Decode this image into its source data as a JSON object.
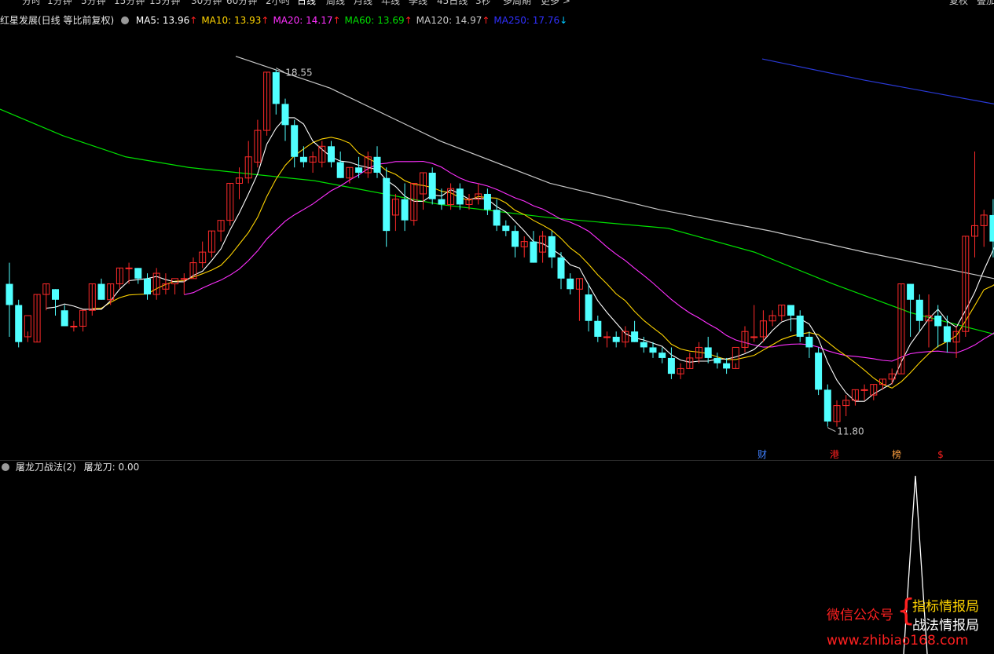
{
  "toolbar": {
    "tabs": [
      "分时",
      "1分钟",
      "5分钟",
      "15分钟",
      "15分钟",
      "30分钟",
      "60分钟",
      "2小时",
      "日线",
      "周线",
      "月线",
      "年线",
      "季线",
      "45日线",
      "3秒",
      "多周期",
      "更多 >"
    ],
    "active_index": 8,
    "right_buttons": [
      "复权",
      "叠加"
    ]
  },
  "stock": {
    "title": "红星发展(日线 等比前复权)"
  },
  "ma": [
    {
      "label": "MA5: 13.96",
      "arrow": "↑",
      "color": "#ffffff",
      "arrow_dir": "up"
    },
    {
      "label": "MA10: 13.93",
      "arrow": "↑",
      "color": "#ffd400",
      "arrow_dir": "up"
    },
    {
      "label": "MA20: 14.17",
      "arrow": "↑",
      "color": "#ff30ff",
      "arrow_dir": "up"
    },
    {
      "label": "MA60: 13.69",
      "arrow": "↑",
      "color": "#00e000",
      "arrow_dir": "up"
    },
    {
      "label": "MA120: 14.97",
      "arrow": "↑",
      "color": "#c8c8c8",
      "arrow_dir": "up"
    },
    {
      "label": "MA250: 17.76",
      "arrow": "↓",
      "color": "#3030ff",
      "arrow_dir": "down"
    }
  ],
  "colors": {
    "up": "#ff2a2a",
    "down": "#50ffff",
    "ma5": "#ffffff",
    "ma10": "#ffd400",
    "ma20": "#ff30ff",
    "ma60": "#00e000",
    "ma120": "#c8c8c8",
    "ma250": "#2a3ad8"
  },
  "chart_data": {
    "type": "candlestick",
    "price_range": [
      11.2,
      19.3
    ],
    "annotations": {
      "high": "18.55",
      "low": "11.80"
    },
    "markers": [
      {
        "index": 80,
        "text": "财",
        "color": "#4080ff"
      },
      {
        "index": 88,
        "text": "港",
        "color": "#ff2020"
      },
      {
        "index": 95,
        "text": "榜",
        "color": "#ffa040"
      },
      {
        "index": 100,
        "text": "$",
        "color": "#ff2020"
      }
    ],
    "candles": [
      [
        14.5,
        14.9,
        14.1,
        13.5
      ],
      [
        14.1,
        14.2,
        13.4,
        13.3
      ],
      [
        13.5,
        13.6,
        13.9,
        13.4
      ],
      [
        13.4,
        14.3,
        14.3,
        13.4
      ],
      [
        14.3,
        14.5,
        14.5,
        14.0
      ],
      [
        14.4,
        14.4,
        14.2,
        13.9
      ],
      [
        14.0,
        14.1,
        13.7,
        13.7
      ],
      [
        13.7,
        13.8,
        13.7,
        13.6
      ],
      [
        13.7,
        14.0,
        14.0,
        13.6
      ],
      [
        14.0,
        14.5,
        14.5,
        13.9
      ],
      [
        14.5,
        14.6,
        14.2,
        14.2
      ],
      [
        14.2,
        14.5,
        14.5,
        14.1
      ],
      [
        14.5,
        14.8,
        14.8,
        14.4
      ],
      [
        14.8,
        14.9,
        14.8,
        14.5
      ],
      [
        14.8,
        14.8,
        14.6,
        14.5
      ],
      [
        14.6,
        14.7,
        14.3,
        14.2
      ],
      [
        14.3,
        14.8,
        14.7,
        14.2
      ],
      [
        14.4,
        14.7,
        14.5,
        14.3
      ],
      [
        14.5,
        14.5,
        14.6,
        14.3
      ],
      [
        14.6,
        14.7,
        14.6,
        14.3
      ],
      [
        14.6,
        15.0,
        14.9,
        14.6
      ],
      [
        14.9,
        15.3,
        15.1,
        14.8
      ],
      [
        15.1,
        15.5,
        15.5,
        15.0
      ],
      [
        15.5,
        15.7,
        15.7,
        15.3
      ],
      [
        15.7,
        16.4,
        16.4,
        15.6
      ],
      [
        16.4,
        16.7,
        16.5,
        16.1
      ],
      [
        16.5,
        17.2,
        16.9,
        16.4
      ],
      [
        16.8,
        17.6,
        17.4,
        16.7
      ],
      [
        17.4,
        18.5,
        18.5,
        17.3
      ],
      [
        18.5,
        18.55,
        17.9,
        17.7
      ],
      [
        17.9,
        18.0,
        17.5,
        17.2
      ],
      [
        17.5,
        17.6,
        16.9,
        16.7
      ],
      [
        16.9,
        17.1,
        16.8,
        16.7
      ],
      [
        16.8,
        17.0,
        16.9,
        16.6
      ],
      [
        16.8,
        17.2,
        17.1,
        16.7
      ],
      [
        17.1,
        17.2,
        16.8,
        16.7
      ],
      [
        16.8,
        17.0,
        16.5,
        16.5
      ],
      [
        16.5,
        16.7,
        16.7,
        16.4
      ],
      [
        16.7,
        16.9,
        16.6,
        16.5
      ],
      [
        16.6,
        17.0,
        16.9,
        16.5
      ],
      [
        16.9,
        17.1,
        16.6,
        16.5
      ],
      [
        16.5,
        16.7,
        15.5,
        15.2
      ],
      [
        15.8,
        16.2,
        16.1,
        15.5
      ],
      [
        16.1,
        16.4,
        15.7,
        15.5
      ],
      [
        15.7,
        16.4,
        16.4,
        15.6
      ],
      [
        16.2,
        16.6,
        16.6,
        15.9
      ],
      [
        16.6,
        16.7,
        16.1,
        16.0
      ],
      [
        16.1,
        16.3,
        16.0,
        15.9
      ],
      [
        16.0,
        16.4,
        16.3,
        15.9
      ],
      [
        16.3,
        16.4,
        16.0,
        15.9
      ],
      [
        16.0,
        16.2,
        16.1,
        15.9
      ],
      [
        16.1,
        16.4,
        16.2,
        16.0
      ],
      [
        16.2,
        16.3,
        15.9,
        15.8
      ],
      [
        15.9,
        16.1,
        15.6,
        15.5
      ],
      [
        15.6,
        15.7,
        15.5,
        15.4
      ],
      [
        15.5,
        15.6,
        15.2,
        15.0
      ],
      [
        15.2,
        15.4,
        15.3,
        15.0
      ],
      [
        15.3,
        15.5,
        14.9,
        14.9
      ],
      [
        15.1,
        15.5,
        15.4,
        14.9
      ],
      [
        15.4,
        15.5,
        15.0,
        14.8
      ],
      [
        15.0,
        15.1,
        14.6,
        14.4
      ],
      [
        14.6,
        14.7,
        14.4,
        14.3
      ],
      [
        14.4,
        14.6,
        14.6,
        13.8
      ],
      [
        14.3,
        14.5,
        13.8,
        13.6
      ],
      [
        13.8,
        13.9,
        13.5,
        13.4
      ],
      [
        13.5,
        13.6,
        13.5,
        13.3
      ],
      [
        13.5,
        13.6,
        13.4,
        13.3
      ],
      [
        13.4,
        13.7,
        13.6,
        13.3
      ],
      [
        13.6,
        13.8,
        13.4,
        13.4
      ],
      [
        13.4,
        13.5,
        13.3,
        13.2
      ],
      [
        13.3,
        13.4,
        13.2,
        13.1
      ],
      [
        13.2,
        13.3,
        13.1,
        13.0
      ],
      [
        13.1,
        13.3,
        12.8,
        12.7
      ],
      [
        12.8,
        13.0,
        12.9,
        12.7
      ],
      [
        12.9,
        13.2,
        13.1,
        12.9
      ],
      [
        13.1,
        13.4,
        13.3,
        13.0
      ],
      [
        13.3,
        13.5,
        13.1,
        13.0
      ],
      [
        13.1,
        13.2,
        13.0,
        12.9
      ],
      [
        13.0,
        13.1,
        12.9,
        12.8
      ],
      [
        12.9,
        13.0,
        13.3,
        12.9
      ],
      [
        13.3,
        13.7,
        13.6,
        13.2
      ],
      [
        13.5,
        14.1,
        13.5,
        13.4
      ],
      [
        13.5,
        14.0,
        13.8,
        13.4
      ],
      [
        13.8,
        14.0,
        13.9,
        13.7
      ],
      [
        13.9,
        14.1,
        14.1,
        13.8
      ],
      [
        14.1,
        14.1,
        13.9,
        13.6
      ],
      [
        13.9,
        14.0,
        13.5,
        13.4
      ],
      [
        13.5,
        13.6,
        13.3,
        13.1
      ],
      [
        13.2,
        13.3,
        12.5,
        12.4
      ],
      [
        12.5,
        12.6,
        11.9,
        11.8
      ]
    ],
    "ma5": [],
    "ma10": [],
    "ma20": [],
    "ma60": [],
    "ma120": [],
    "ma250": []
  },
  "indicator": {
    "name": "屠龙刀战法(2)",
    "value_label": "屠龙刀: 0.00"
  },
  "watermark": {
    "wechat": "微信公众号",
    "brace": "{",
    "line1": "指标情报局",
    "line2": "战法情报局",
    "url": "www.zhibiao168.com"
  }
}
